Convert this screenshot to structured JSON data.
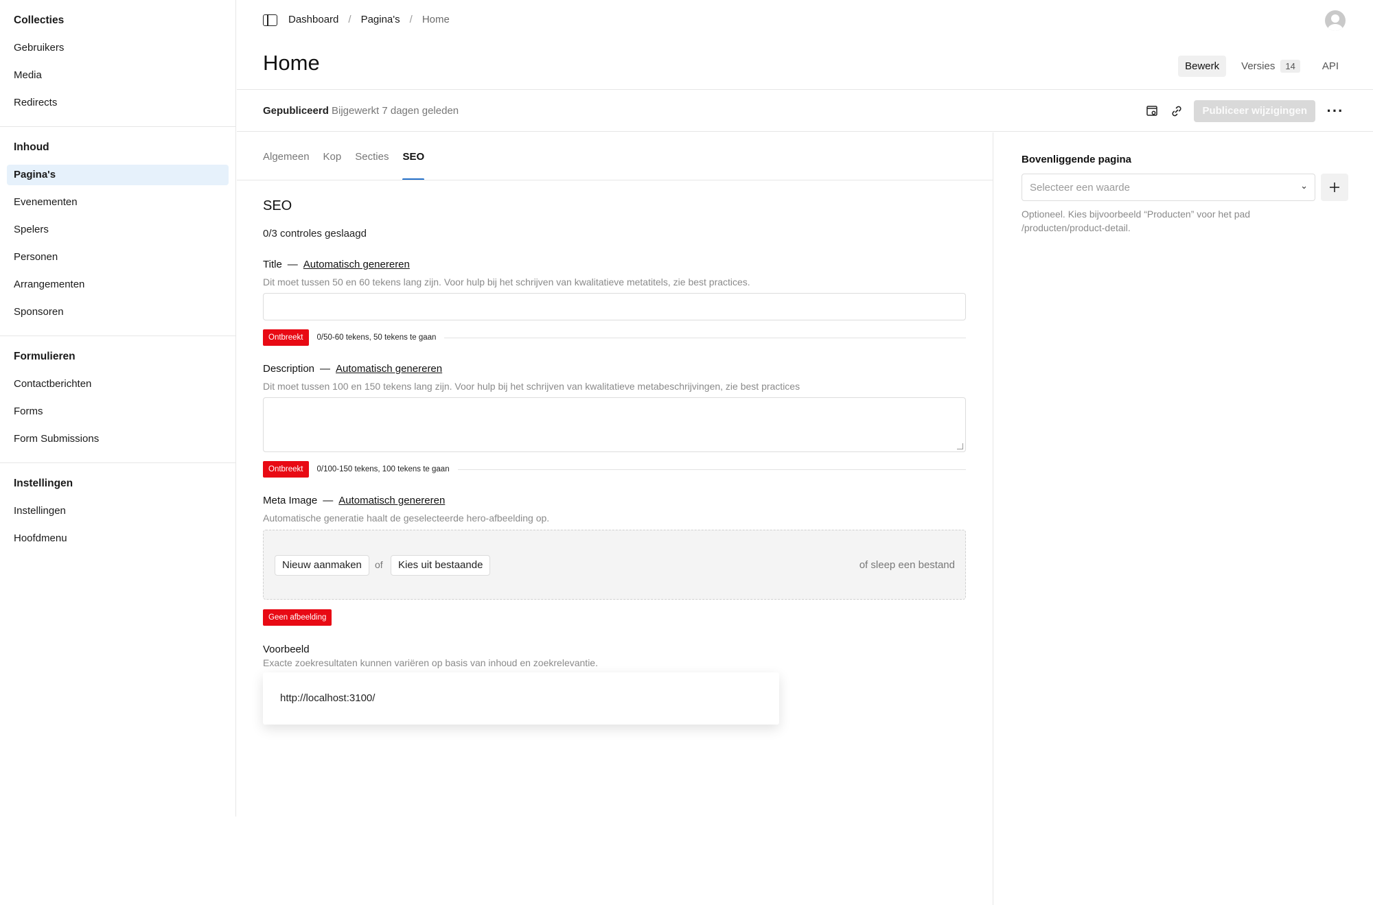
{
  "sidebar": {
    "groups": [
      {
        "heading": "Collecties",
        "items": [
          "Gebruikers",
          "Media",
          "Redirects"
        ]
      },
      {
        "heading": "Inhoud",
        "items": [
          "Pagina's",
          "Evenementen",
          "Spelers",
          "Personen",
          "Arrangementen",
          "Sponsoren"
        ],
        "active": "Pagina's"
      },
      {
        "heading": "Formulieren",
        "items": [
          "Contactberichten",
          "Forms",
          "Form Submissions"
        ]
      },
      {
        "heading": "Instellingen",
        "items": [
          "Instellingen",
          "Hoofdmenu"
        ]
      }
    ]
  },
  "header": {
    "breadcrumb": [
      "Dashboard",
      "Pagina's",
      "Home"
    ],
    "title": "Home",
    "tabs": {
      "edit": "Bewerk",
      "versions": "Versies",
      "versions_count": "14",
      "api": "API"
    }
  },
  "status": {
    "state": "Gepubliceerd",
    "updated": "Bijgewerkt 7 dagen geleden",
    "publish_label": "Publiceer wijzigingen",
    "icons": [
      "live-preview-icon",
      "link-icon",
      "more-icon"
    ]
  },
  "tabs": [
    "Algemeen",
    "Kop",
    "Secties",
    "SEO"
  ],
  "active_tab": "SEO",
  "seo": {
    "heading": "SEO",
    "checks": "0/3 controles geslaagd",
    "generate_label": "Automatisch genereren",
    "title_field": {
      "label": "Title",
      "help": "Dit moet tussen 50 en 60 tekens lang zijn. Voor hulp bij het schrijven van kwalitatieve metatitels, zie best practices.",
      "value": "",
      "badge": "Ontbreekt",
      "meter": "0/50-60 tekens, 50 tekens te gaan"
    },
    "description_field": {
      "label": "Description",
      "help": "Dit moet tussen 100 en 150 tekens lang zijn. Voor hulp bij het schrijven van kwalitatieve metabeschrijvingen, zie best practices",
      "value": "",
      "badge": "Ontbreekt",
      "meter": "0/100-150 tekens, 100 tekens te gaan"
    },
    "image_field": {
      "label": "Meta Image",
      "help": "Automatische generatie haalt de geselecteerde hero-afbeelding op.",
      "create_label": "Nieuw aanmaken",
      "or_label": "of",
      "choose_label": "Kies uit bestaande",
      "drag_label": "of sleep een bestand",
      "badge": "Geen afbeelding"
    },
    "preview": {
      "title": "Voorbeeld",
      "help": "Exacte zoekresultaten kunnen variëren op basis van inhoud en zoekrelevantie.",
      "url": "http://localhost:3100/"
    }
  },
  "aside": {
    "parent_label": "Bovenliggende pagina",
    "placeholder": "Selecteer een waarde",
    "help": "Optioneel. Kies bijvoorbeeld “Producten” voor het pad /producten/product-detail."
  },
  "colors": {
    "accent": "#2470c9",
    "error": "#e80a14",
    "active_nav": "#e6f1fb"
  }
}
